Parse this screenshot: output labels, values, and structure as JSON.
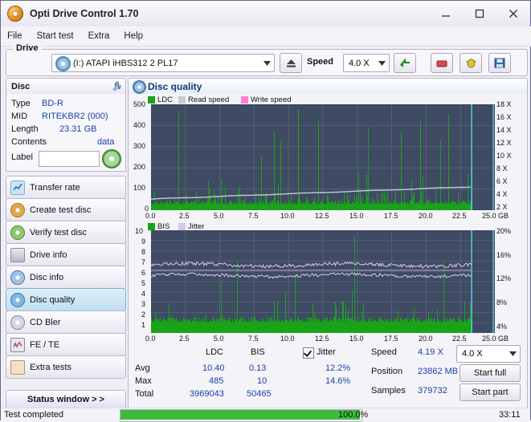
{
  "window": {
    "title": "Opti Drive Control 1.70",
    "icon": "app-disc-icon",
    "minimize": "minimize",
    "maximize": "maximize",
    "close": "close"
  },
  "menu": [
    "File",
    "Start test",
    "Extra",
    "Help"
  ],
  "drive": {
    "group_label": "Drive",
    "selected": "(I:)  ATAPI iHBS312   2 PL17",
    "eject_icon": "eject-icon",
    "speed_label": "Speed",
    "speed_value": "4.0 X",
    "toolbar_icons": [
      "refresh-green-icon",
      "eraser-icon",
      "bug-icon",
      "save-icon"
    ]
  },
  "disc": {
    "panel_title": "Disc",
    "panel_icon": "wrench-icon",
    "rows": [
      {
        "label": "Type",
        "value": "BD-R"
      },
      {
        "label": "MID",
        "value": "RITEKBR2 (000)"
      },
      {
        "label": "Length",
        "value": "23.31 GB"
      },
      {
        "label": "Contents",
        "value": "data"
      },
      {
        "label": "Label",
        "value": ""
      }
    ],
    "refresh_icon": "refresh-disc-icon"
  },
  "sidebar": {
    "items": [
      {
        "label": "Transfer rate",
        "icon": "chart-icon",
        "active": false
      },
      {
        "label": "Create test disc",
        "icon": "disc-write-icon",
        "active": false
      },
      {
        "label": "Verify test disc",
        "icon": "check-disc-icon",
        "active": false
      },
      {
        "label": "Drive info",
        "icon": "drive-icon",
        "active": false
      },
      {
        "label": "Disc info",
        "icon": "disc-info-icon",
        "active": false
      },
      {
        "label": "Disc quality",
        "icon": "quality-icon",
        "active": true
      },
      {
        "label": "CD Bler",
        "icon": "cd-bler-icon",
        "active": false
      },
      {
        "label": "FE / TE",
        "icon": "fete-icon",
        "active": false
      },
      {
        "label": "Extra tests",
        "icon": "extra-icon",
        "active": false
      }
    ],
    "status_window": "Status window > >"
  },
  "quality": {
    "header": "Disc quality",
    "header_icon": "disc-quality-icon",
    "legend_top": [
      {
        "label": "LDC",
        "color": "#19a319"
      },
      {
        "label": "Read speed",
        "color": "#c9c9d8"
      },
      {
        "label": "Write speed",
        "color": "#ff7fd4"
      }
    ],
    "legend_bottom": [
      {
        "label": "BIS",
        "color": "#19a319"
      },
      {
        "label": "Jitter",
        "color": "#d8c8ec"
      }
    ],
    "stats": {
      "col_ldc": "LDC",
      "col_bis": "BIS",
      "jitter_label": "Jitter",
      "jitter_checked": true,
      "rows": [
        {
          "name": "Avg",
          "ldc": "10.40",
          "bis": "0.13",
          "jitter": "12.2%"
        },
        {
          "name": "Max",
          "ldc": "485",
          "bis": "10",
          "jitter": "14.6%"
        },
        {
          "name": "Total",
          "ldc": "3969043",
          "bis": "50465",
          "jitter": ""
        }
      ],
      "speed_label": "Speed",
      "speed_value": "4.19 X",
      "speed_select": "4.0 X",
      "position_label": "Position",
      "position_value": "23862 MB",
      "samples_label": "Samples",
      "samples_value": "379732",
      "start_full": "Start full",
      "start_part": "Start part"
    }
  },
  "chart_data": [
    {
      "type": "line",
      "name": "LDC / speed chart",
      "title": "",
      "xlabel": "GB",
      "ylabel": "",
      "x_ticks": [
        "0.0",
        "2.5",
        "5.0",
        "7.5",
        "10.0",
        "12.5",
        "15.0",
        "17.5",
        "20.0",
        "22.5",
        "25.0 GB"
      ],
      "xlim": [
        0,
        25
      ],
      "y_ticks": [
        "0",
        "100",
        "200",
        "300",
        "400",
        "500"
      ],
      "ylim": [
        0,
        500
      ],
      "y2_ticks": [
        "2 X",
        "4 X",
        "6 X",
        "8 X",
        "10 X",
        "12 X",
        "14 X",
        "16 X",
        "18 X"
      ],
      "y2lim": [
        0,
        19
      ],
      "grid": true,
      "background": "#3f4a63",
      "series": [
        {
          "name": "LDC",
          "color": "#19a319",
          "type": "spikes",
          "baseline": 25,
          "peak_max": 485
        },
        {
          "name": "Read speed",
          "color": "#c9c9d8",
          "type": "line",
          "start_x": 0,
          "start_value": 2.0,
          "end_value": 4.2
        },
        {
          "name": "Write speed",
          "color": "#ff7fd4",
          "type": "line",
          "value": null
        }
      ]
    },
    {
      "type": "line",
      "name": "BIS / jitter chart",
      "title": "",
      "xlabel": "GB",
      "x_ticks": [
        "0.0",
        "2.5",
        "5.0",
        "7.5",
        "10.0",
        "12.5",
        "15.0",
        "17.5",
        "20.0",
        "22.5",
        "25.0 GB"
      ],
      "xlim": [
        0,
        25
      ],
      "y_ticks": [
        "1",
        "2",
        "3",
        "4",
        "5",
        "6",
        "7",
        "8",
        "9",
        "10"
      ],
      "ylim": [
        0,
        10
      ],
      "y2_ticks": [
        "4%",
        "8%",
        "12%",
        "16%",
        "20%"
      ],
      "y2lim": [
        0,
        20
      ],
      "grid": true,
      "background": "#3f4a63",
      "series": [
        {
          "name": "BIS",
          "color": "#19a319",
          "type": "area",
          "avg": 1.0,
          "max": 10
        },
        {
          "name": "Jitter",
          "color": "#d8c8ec",
          "type": "line",
          "avg": 12.2,
          "max": 14.6
        }
      ]
    }
  ],
  "statusbar": {
    "message": "Test completed",
    "progress_percent": 100,
    "progress_text": "100.0%",
    "clock": "33:11"
  }
}
